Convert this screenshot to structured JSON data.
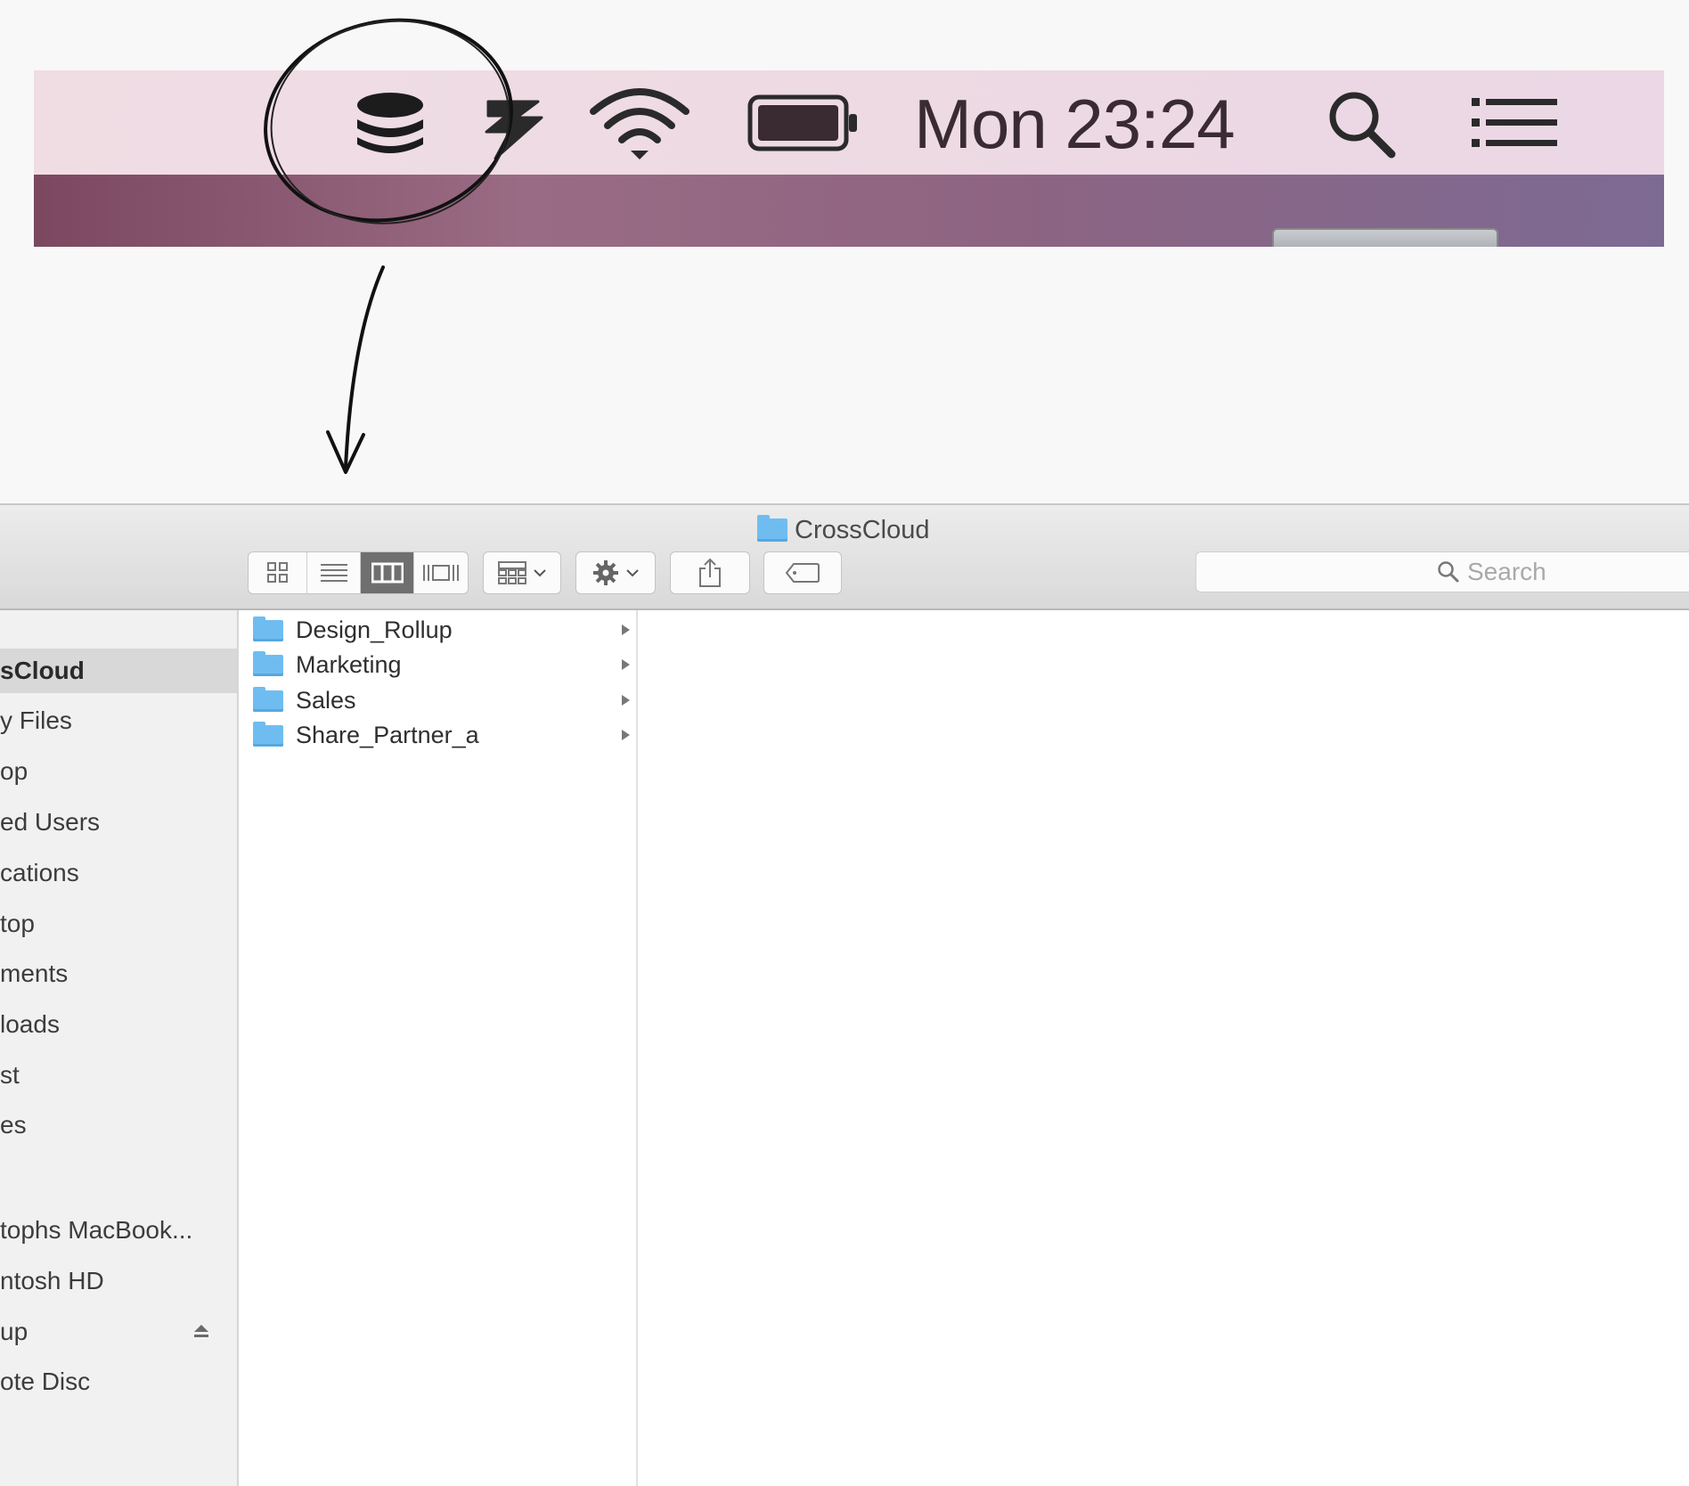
{
  "menubar": {
    "clock": "Mon 23:24",
    "icons": [
      "crosscloud-database-icon",
      "bolt-app-icon",
      "wifi-icon",
      "battery-icon",
      "spotlight-search-icon",
      "notification-center-icon"
    ]
  },
  "finder": {
    "title": "CrossCloud",
    "search_placeholder": "Search",
    "toolbar": {
      "view_buttons": [
        "icon-view",
        "list-view",
        "column-view",
        "cover-flow-view"
      ],
      "active_view": "column-view"
    },
    "sidebar": {
      "items": [
        {
          "label": "sCloud",
          "selected": true
        },
        {
          "label": "y Files"
        },
        {
          "label": "op"
        },
        {
          "label": "ed Users"
        },
        {
          "label": "cations"
        },
        {
          "label": "top"
        },
        {
          "label": "ments"
        },
        {
          "label": "loads"
        },
        {
          "label": "st"
        },
        {
          "label": "es"
        }
      ],
      "devices": [
        {
          "label": "tophs MacBook..."
        },
        {
          "label": "ntosh HD"
        },
        {
          "label": "up",
          "ejectable": true
        },
        {
          "label": "ote Disc"
        }
      ]
    },
    "column1": [
      {
        "name": "Design_Rollup"
      },
      {
        "name": "Marketing"
      },
      {
        "name": "Sales"
      },
      {
        "name": "Share_Partner_a"
      }
    ]
  },
  "colors": {
    "menubar_bg": "#eddae3",
    "folder_blue": "#6fbdf0",
    "sidebar_selected": "#d8d8d8"
  }
}
